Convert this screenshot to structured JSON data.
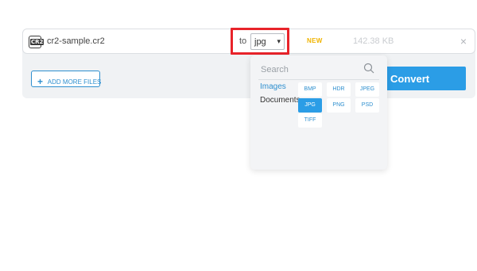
{
  "file": {
    "icon_tag": "CR2",
    "name": "cr2-sample.cr2",
    "to_label": "to",
    "selected_format": "jpg",
    "status": "NEW",
    "size": "142.38 KB",
    "close_glyph": "×"
  },
  "actions": {
    "add_files_label": "ADD MORE FILES",
    "add_files_plus": "+",
    "convert_label": "Convert"
  },
  "dropdown": {
    "search_placeholder": "Search",
    "categories": [
      {
        "label": "Images",
        "active": true
      },
      {
        "label": "Documents",
        "active": false
      }
    ],
    "formats": [
      "BMP",
      "HDR",
      "JPEG",
      "JPG",
      "PNG",
      "PSD",
      "TIFF"
    ],
    "selected_format": "JPG"
  },
  "colors": {
    "accent": "#2b9de6",
    "highlight": "#e8232a",
    "badge": "#f0b400"
  }
}
